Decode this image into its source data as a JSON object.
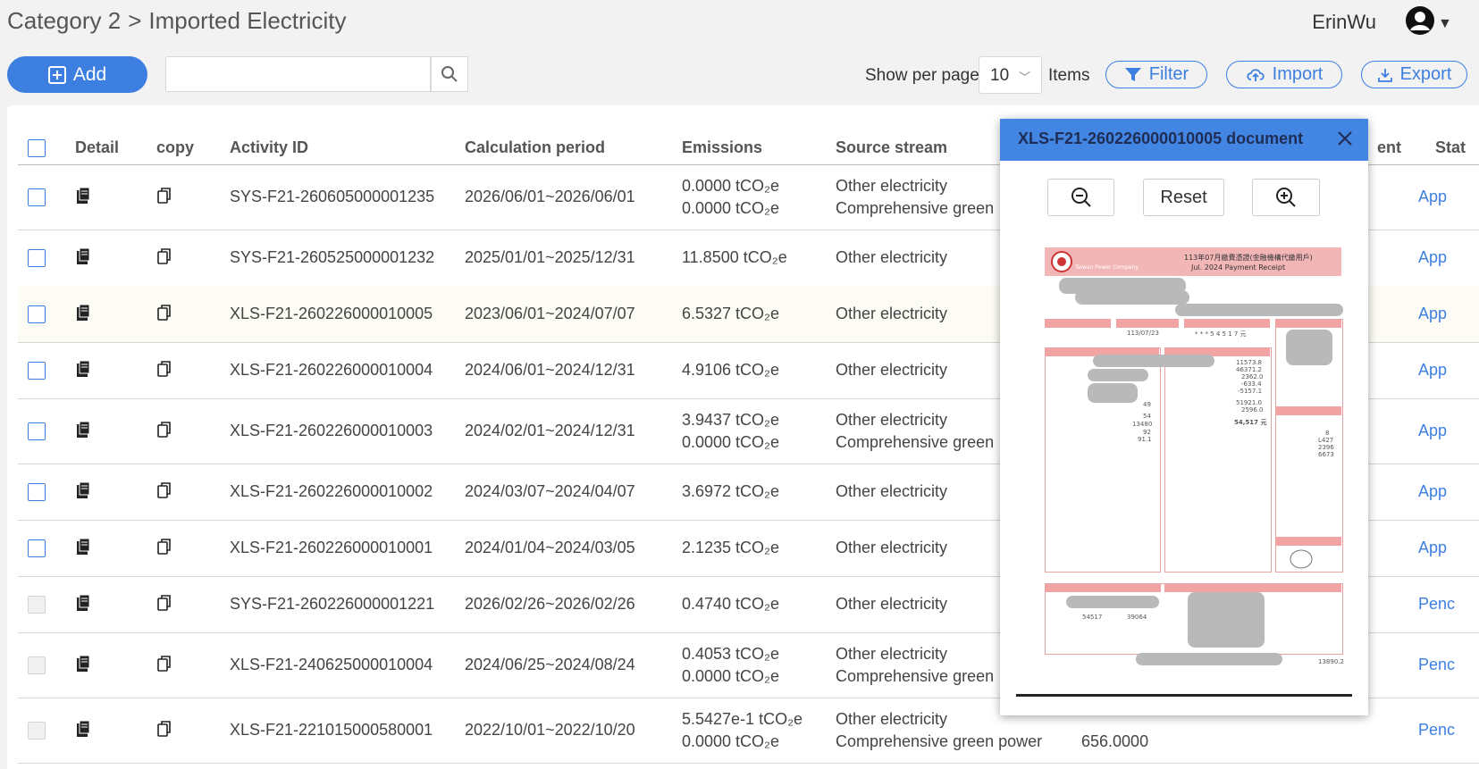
{
  "breadcrumb": {
    "category": "Category 2",
    "separator": ">",
    "page": "Imported Electricity"
  },
  "user": {
    "name": "ErinWu",
    "icon": "user-avatar-icon"
  },
  "toolbar": {
    "add_label": "Add",
    "search_placeholder": "",
    "show_per_page_label": "Show per page",
    "per_page_value": "10",
    "items_label": "Items",
    "filter_label": "Filter",
    "import_label": "Import",
    "export_label": "Export"
  },
  "table": {
    "headers": [
      "Detail",
      "copy",
      "Activity ID",
      "Calculation period",
      "Emissions",
      "Source stream",
      "ent",
      "Stat"
    ],
    "rows": [
      {
        "id": "SYS-F21-260605000001235",
        "period": "2026/06/01~2026/06/01",
        "em1": "0.0000 tCO₂e",
        "em2": "0.0000 tCO₂e",
        "src1": "Other electricity",
        "src2": "Comprehensive green",
        "extra": "",
        "status": "App"
      },
      {
        "id": "SYS-F21-260525000001232",
        "period": "2025/01/01~2025/12/31",
        "em1": "11.8500 tCO₂e",
        "em2": "",
        "src1": "Other electricity",
        "src2": "",
        "extra": "",
        "status": "App"
      },
      {
        "id": "XLS-F21-260226000010005",
        "period": "2023/06/01~2024/07/07",
        "em1": "6.5327 tCO₂e",
        "em2": "",
        "src1": "Other electricity",
        "src2": "",
        "extra": "",
        "status": "App"
      },
      {
        "id": "XLS-F21-260226000010004",
        "period": "2024/06/01~2024/12/31",
        "em1": "4.9106 tCO₂e",
        "em2": "",
        "src1": "Other electricity",
        "src2": "",
        "extra": "",
        "status": "App"
      },
      {
        "id": "XLS-F21-260226000010003",
        "period": "2024/02/01~2024/12/31",
        "em1": "3.9437 tCO₂e",
        "em2": "0.0000 tCO₂e",
        "src1": "Other electricity",
        "src2": "Comprehensive green",
        "extra": "",
        "status": "App"
      },
      {
        "id": "XLS-F21-260226000010002",
        "period": "2024/03/07~2024/04/07",
        "em1": "3.6972 tCO₂e",
        "em2": "",
        "src1": "Other electricity",
        "src2": "",
        "extra": "",
        "status": "App"
      },
      {
        "id": "XLS-F21-260226000010001",
        "period": "2024/01/04~2024/03/05",
        "em1": "2.1235 tCO₂e",
        "em2": "",
        "src1": "Other electricity",
        "src2": "",
        "extra": "",
        "status": "App"
      },
      {
        "id": "SYS-F21-260226000001221",
        "period": "2026/02/26~2026/02/26",
        "em1": "0.4740 tCO₂e",
        "em2": "",
        "src1": "Other electricity",
        "src2": "",
        "extra": "",
        "status": "Penc"
      },
      {
        "id": "XLS-F21-240625000010004",
        "period": "2024/06/25~2024/08/24",
        "em1": "0.4053 tCO₂e",
        "em2": "0.0000 tCO₂e",
        "src1": "Other electricity",
        "src2": "Comprehensive green",
        "extra": "",
        "status": "Penc"
      },
      {
        "id": "XLS-F21-221015000580001",
        "period": "2022/10/01~2022/10/20",
        "em1": "5.5427e-1 tCO₂e",
        "em2": "0.0000 tCO₂e",
        "src1": "Other electricity",
        "src2": "Comprehensive green power",
        "extra": "656.0000",
        "status": "Penc"
      }
    ]
  },
  "modal": {
    "title": "XLS-F21-260226000010005 document",
    "reset_label": "Reset",
    "doc": {
      "heading": "113年07月繳費憑證(金融機構代繳用戶)",
      "subheading": "Jul. 2024 Payment Receipt",
      "company": "Taiwan Power Company",
      "date": "113/07/23",
      "amount": "* * * 5 4 5 1 7 元",
      "total": "54,517 元",
      "energy": "13480",
      "charges": [
        "11573.8",
        "46371.2",
        "2362.0",
        "-633.4",
        "-5157.1"
      ],
      "subtotal": "51921.0",
      "tax": "2596.0",
      "fieldnum": "49",
      "fieldnum2": "54",
      "pct1": "92",
      "pct2": "91.1",
      "other": [
        "8",
        "L427",
        "2396",
        "6673"
      ],
      "inv1": "54517",
      "inv2": "39064",
      "serial": "13890.2"
    }
  },
  "colors": {
    "accent": "#3d7fe0",
    "modal_header": "#4285e3",
    "receipt_red": "#e06b6b"
  }
}
